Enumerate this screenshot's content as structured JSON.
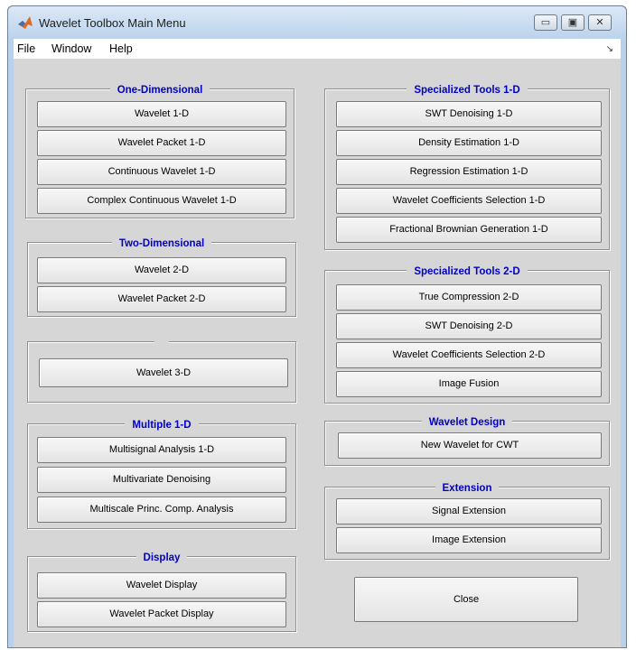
{
  "window": {
    "title": "Wavelet Toolbox Main Menu",
    "minimize": "▭",
    "maximize": "▣",
    "close": "✕"
  },
  "menu": {
    "file": "File",
    "window": "Window",
    "help": "Help",
    "dock": "↘"
  },
  "one_dimensional": {
    "title": "One-Dimensional",
    "buttons": [
      "Wavelet 1-D",
      "Wavelet Packet 1-D",
      "Continuous Wavelet 1-D",
      "Complex Continuous Wavelet 1-D"
    ]
  },
  "two_dimensional": {
    "title": "Two-Dimensional",
    "buttons": [
      "Wavelet 2-D",
      "Wavelet Packet 2-D"
    ]
  },
  "three_dimensional": {
    "title": "",
    "buttons": [
      "Wavelet 3-D"
    ]
  },
  "multiple_1d": {
    "title": "Multiple 1-D",
    "buttons": [
      "Multisignal Analysis 1-D",
      "Multivariate Denoising",
      "Multiscale Princ. Comp. Analysis"
    ]
  },
  "display": {
    "title": "Display",
    "buttons": [
      "Wavelet Display",
      "Wavelet Packet Display"
    ]
  },
  "specialized_1d": {
    "title": "Specialized Tools 1-D",
    "buttons": [
      "SWT Denoising 1-D",
      "Density Estimation 1-D",
      "Regression Estimation 1-D",
      "Wavelet Coefficients Selection 1-D",
      "Fractional Brownian Generation 1-D"
    ]
  },
  "specialized_2d": {
    "title": "Specialized Tools 2-D",
    "buttons": [
      "True Compression 2-D",
      "SWT Denoising 2-D",
      "Wavelet Coefficients Selection 2-D",
      "Image Fusion"
    ]
  },
  "wavelet_design": {
    "title": "Wavelet Design",
    "buttons": [
      "New Wavelet for CWT"
    ]
  },
  "extension": {
    "title": "Extension",
    "buttons": [
      "Signal Extension",
      "Image Extension"
    ]
  },
  "close_label": "Close"
}
